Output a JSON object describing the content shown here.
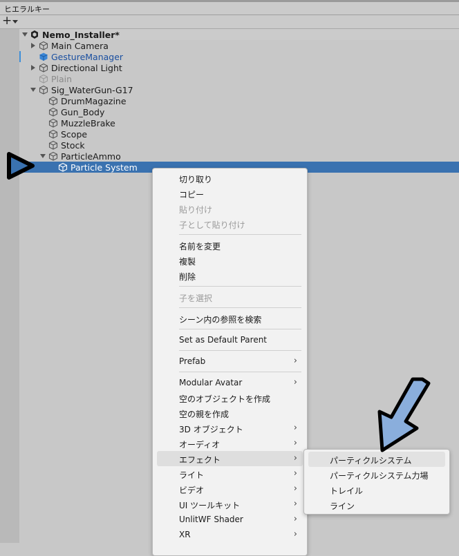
{
  "window": {
    "title": "ヒエラルキー"
  },
  "toolbar": {
    "add_symbol": "+"
  },
  "hierarchy": {
    "root": "Nemo_Installer*",
    "rows": [
      {
        "label": "Main Camera"
      },
      {
        "label": "GestureManager"
      },
      {
        "label": "Directional Light"
      },
      {
        "label": "Plain"
      },
      {
        "label": "Sig_WaterGun-G17"
      },
      {
        "label": "DrumMagazine"
      },
      {
        "label": "Gun_Body"
      },
      {
        "label": "MuzzleBrake"
      },
      {
        "label": "Scope"
      },
      {
        "label": "Stock"
      },
      {
        "label": "ParticleAmmo"
      },
      {
        "label": "Particle System"
      }
    ]
  },
  "context_menu": {
    "items": [
      {
        "label": "切り取り"
      },
      {
        "label": "コピー"
      },
      {
        "label": "貼り付け"
      },
      {
        "label": "子として貼り付け"
      },
      {
        "label": "名前を変更"
      },
      {
        "label": "複製"
      },
      {
        "label": "削除"
      },
      {
        "label": "子を選択"
      },
      {
        "label": "シーン内の参照を検索"
      },
      {
        "label": "Set as Default Parent"
      },
      {
        "label": "Prefab"
      },
      {
        "label": "Modular Avatar"
      },
      {
        "label": "空のオブジェクトを作成"
      },
      {
        "label": "空の親を作成"
      },
      {
        "label": "3D オブジェクト"
      },
      {
        "label": "オーディオ"
      },
      {
        "label": "エフェクト"
      },
      {
        "label": "ライト"
      },
      {
        "label": "ビデオ"
      },
      {
        "label": "UI ツールキット"
      },
      {
        "label": "UnlitWF Shader"
      },
      {
        "label": "XR"
      }
    ],
    "chevron": "›"
  },
  "effects_submenu": {
    "items": [
      {
        "label": "パーティクルシステム"
      },
      {
        "label": "パーティクルシステム力場"
      },
      {
        "label": "トレイル"
      },
      {
        "label": "ライン"
      }
    ]
  },
  "colors": {
    "selection": "#3a72b0",
    "annotation_arrow_fill": "#8aaedc",
    "annotation_outline": "#000000"
  }
}
